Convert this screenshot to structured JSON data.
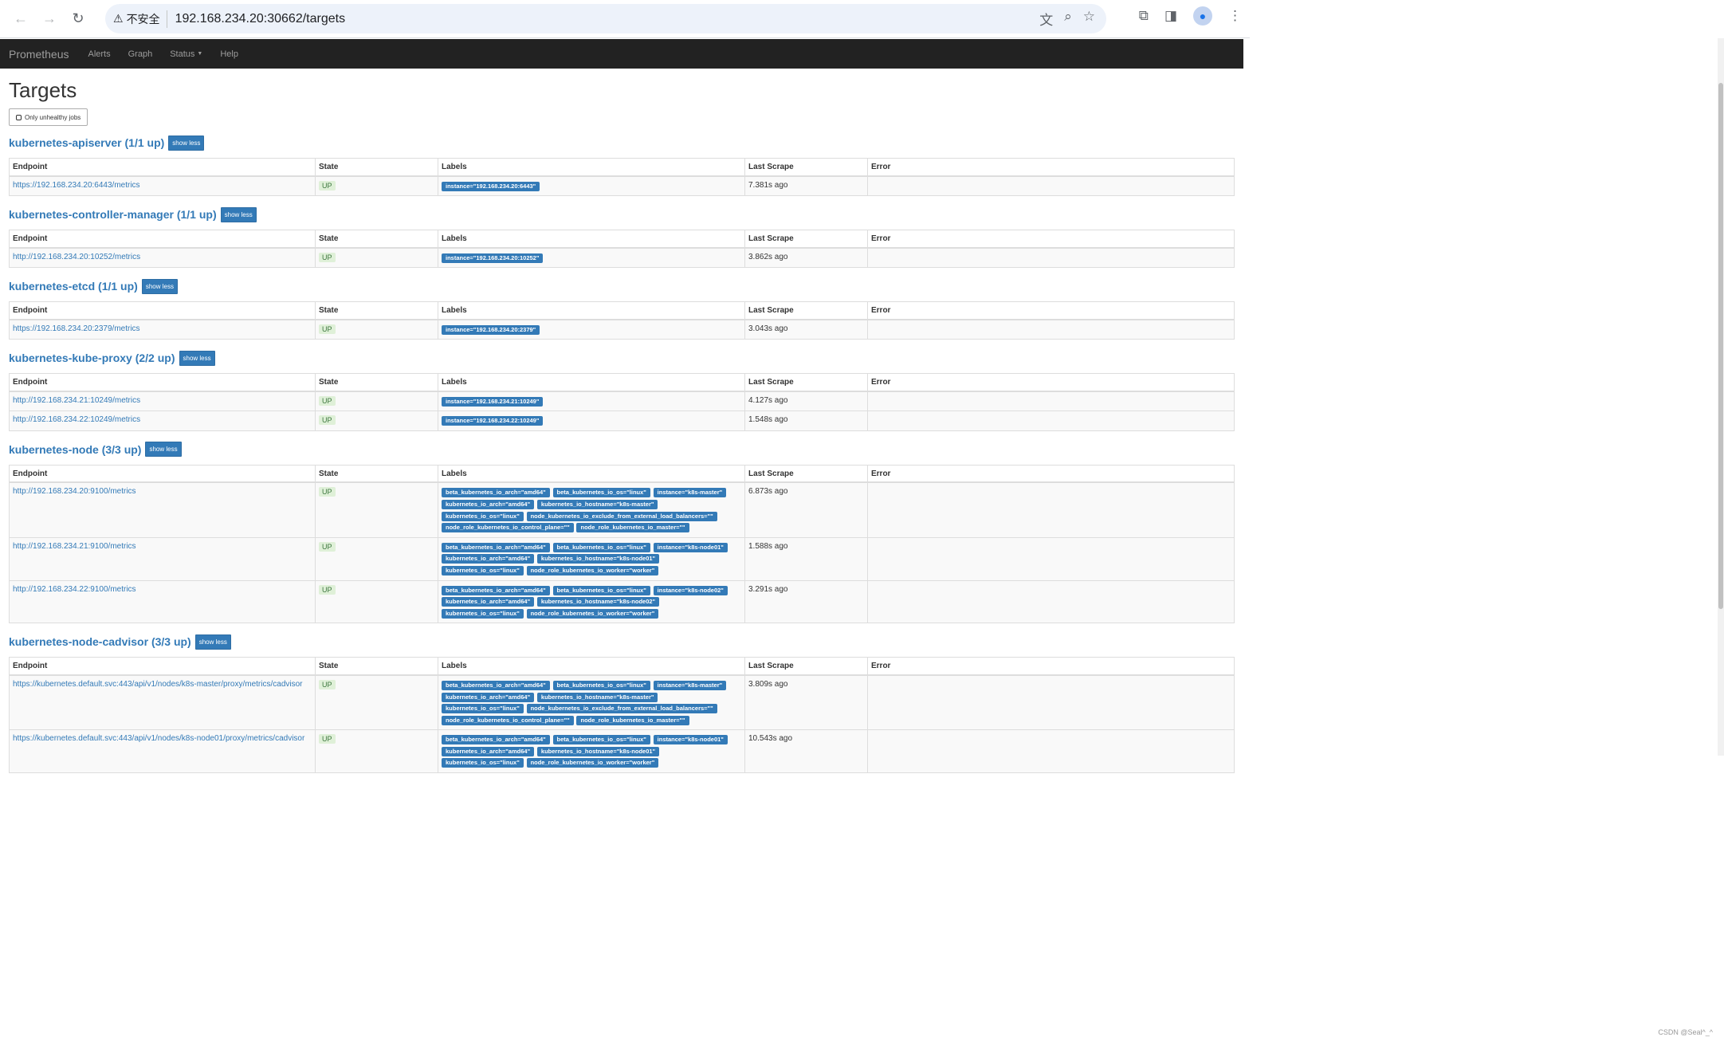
{
  "browser": {
    "security_label": "不安全",
    "url": "192.168.234.20:30662/targets"
  },
  "navbar": {
    "brand": "Prometheus",
    "links": [
      "Alerts",
      "Graph",
      "Status",
      "Help"
    ]
  },
  "page": {
    "title": "Targets",
    "filter_button": "Only unhealthy jobs",
    "show_less_label": "show less",
    "columns": [
      "Endpoint",
      "State",
      "Labels",
      "Last Scrape",
      "Error"
    ]
  },
  "jobs": [
    {
      "title": "kubernetes-apiserver (1/1 up)",
      "rows": [
        {
          "endpoint": "https://192.168.234.20:6443/metrics",
          "state": "UP",
          "labels": [
            "instance=\"192.168.234.20:6443\""
          ],
          "last_scrape": "7.381s ago",
          "error": ""
        }
      ]
    },
    {
      "title": "kubernetes-controller-manager (1/1 up)",
      "rows": [
        {
          "endpoint": "http://192.168.234.20:10252/metrics",
          "state": "UP",
          "labels": [
            "instance=\"192.168.234.20:10252\""
          ],
          "last_scrape": "3.862s ago",
          "error": ""
        }
      ]
    },
    {
      "title": "kubernetes-etcd (1/1 up)",
      "rows": [
        {
          "endpoint": "https://192.168.234.20:2379/metrics",
          "state": "UP",
          "labels": [
            "instance=\"192.168.234.20:2379\""
          ],
          "last_scrape": "3.043s ago",
          "error": ""
        }
      ]
    },
    {
      "title": "kubernetes-kube-proxy (2/2 up)",
      "rows": [
        {
          "endpoint": "http://192.168.234.21:10249/metrics",
          "state": "UP",
          "labels": [
            "instance=\"192.168.234.21:10249\""
          ],
          "last_scrape": "4.127s ago",
          "error": ""
        },
        {
          "endpoint": "http://192.168.234.22:10249/metrics",
          "state": "UP",
          "labels": [
            "instance=\"192.168.234.22:10249\""
          ],
          "last_scrape": "1.548s ago",
          "error": ""
        }
      ]
    },
    {
      "title": "kubernetes-node (3/3 up)",
      "rows": [
        {
          "endpoint": "http://192.168.234.20:9100/metrics",
          "state": "UP",
          "labels": [
            "beta_kubernetes_io_arch=\"amd64\"",
            "beta_kubernetes_io_os=\"linux\"",
            "instance=\"k8s-master\"",
            "kubernetes_io_arch=\"amd64\"",
            "kubernetes_io_hostname=\"k8s-master\"",
            "kubernetes_io_os=\"linux\"",
            "node_kubernetes_io_exclude_from_external_load_balancers=\"\"",
            "node_role_kubernetes_io_control_plane=\"\"",
            "node_role_kubernetes_io_master=\"\""
          ],
          "last_scrape": "6.873s ago",
          "error": ""
        },
        {
          "endpoint": "http://192.168.234.21:9100/metrics",
          "state": "UP",
          "labels": [
            "beta_kubernetes_io_arch=\"amd64\"",
            "beta_kubernetes_io_os=\"linux\"",
            "instance=\"k8s-node01\"",
            "kubernetes_io_arch=\"amd64\"",
            "kubernetes_io_hostname=\"k8s-node01\"",
            "kubernetes_io_os=\"linux\"",
            "node_role_kubernetes_io_worker=\"worker\""
          ],
          "last_scrape": "1.588s ago",
          "error": ""
        },
        {
          "endpoint": "http://192.168.234.22:9100/metrics",
          "state": "UP",
          "labels": [
            "beta_kubernetes_io_arch=\"amd64\"",
            "beta_kubernetes_io_os=\"linux\"",
            "instance=\"k8s-node02\"",
            "kubernetes_io_arch=\"amd64\"",
            "kubernetes_io_hostname=\"k8s-node02\"",
            "kubernetes_io_os=\"linux\"",
            "node_role_kubernetes_io_worker=\"worker\""
          ],
          "last_scrape": "3.291s ago",
          "error": ""
        }
      ]
    },
    {
      "title": "kubernetes-node-cadvisor (3/3 up)",
      "rows": [
        {
          "endpoint": "https://kubernetes.default.svc:443/api/v1/nodes/k8s-master/proxy/metrics/cadvisor",
          "state": "UP",
          "labels": [
            "beta_kubernetes_io_arch=\"amd64\"",
            "beta_kubernetes_io_os=\"linux\"",
            "instance=\"k8s-master\"",
            "kubernetes_io_arch=\"amd64\"",
            "kubernetes_io_hostname=\"k8s-master\"",
            "kubernetes_io_os=\"linux\"",
            "node_kubernetes_io_exclude_from_external_load_balancers=\"\"",
            "node_role_kubernetes_io_control_plane=\"\"",
            "node_role_kubernetes_io_master=\"\""
          ],
          "last_scrape": "3.809s ago",
          "error": ""
        },
        {
          "endpoint": "https://kubernetes.default.svc:443/api/v1/nodes/k8s-node01/proxy/metrics/cadvisor",
          "state": "UP",
          "labels": [
            "beta_kubernetes_io_arch=\"amd64\"",
            "beta_kubernetes_io_os=\"linux\"",
            "instance=\"k8s-node01\"",
            "kubernetes_io_arch=\"amd64\"",
            "kubernetes_io_hostname=\"k8s-node01\"",
            "kubernetes_io_os=\"linux\"",
            "node_role_kubernetes_io_worker=\"worker\""
          ],
          "last_scrape": "10.543s ago",
          "error": ""
        }
      ]
    }
  ],
  "watermark": "CSDN @Seal^_^"
}
